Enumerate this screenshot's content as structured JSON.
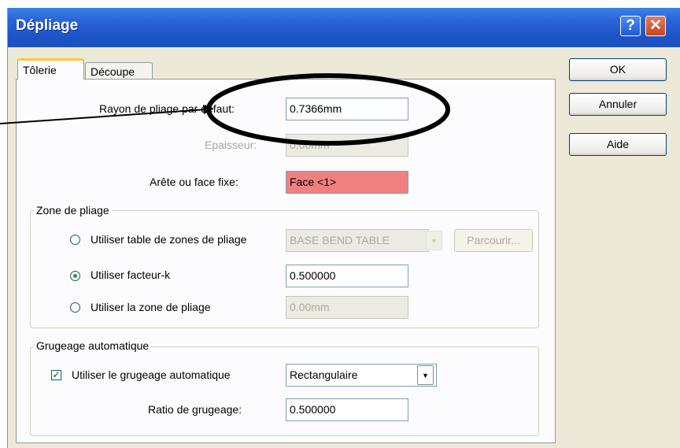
{
  "window": {
    "title": "Dépliage"
  },
  "titlebar_buttons": {
    "help": "?",
    "close": "✕"
  },
  "tabs": [
    {
      "label": "Tôlerie"
    },
    {
      "label": "Découpe"
    }
  ],
  "fields": {
    "rayon": {
      "label": "Rayon de pliage par défaut:",
      "value": "0.7366mm"
    },
    "epaisseur": {
      "label": "Epaisseur:",
      "value": "0.00mm"
    },
    "arete": {
      "label": "Arête ou face fixe:",
      "value": "Face <1>"
    }
  },
  "zone_pliage": {
    "title": "Zone de pliage",
    "options": [
      {
        "label": "Utiliser table de zones de pliage",
        "value": "BASE BEND TABLE",
        "selected": false
      },
      {
        "label": "Utiliser facteur-k",
        "value": "0.500000",
        "selected": true
      },
      {
        "label": "Utiliser la zone de pliage",
        "value": "0.00mm",
        "selected": false
      }
    ],
    "browse_label": "Parcourir..."
  },
  "grugeage": {
    "title": "Grugeage automatique",
    "checkbox_label": "Utiliser le grugeage automatique",
    "checked": true,
    "type_value": "Rectangulaire",
    "ratio_label": "Ratio de grugeage:",
    "ratio_value": "0.500000"
  },
  "buttons": {
    "ok": "OK",
    "cancel": "Annuler",
    "help": "Aide"
  },
  "colors": {
    "titlebar": "#2A66D8",
    "face_highlight": "#F08080",
    "dialog_bg": "#ECE9D8"
  }
}
